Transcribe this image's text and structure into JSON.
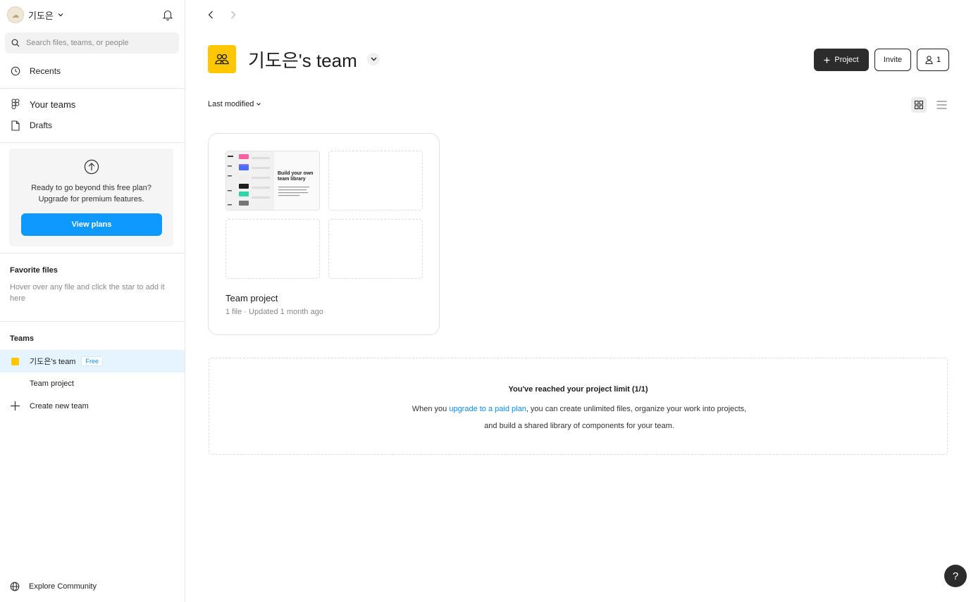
{
  "account": {
    "name": "기도은",
    "avatar_icon": "cloud-avatar-icon"
  },
  "search": {
    "placeholder": "Search files, teams, or people"
  },
  "sidebar": {
    "recents": "Recents",
    "your_teams": "Your teams",
    "drafts": "Drafts",
    "upgrade": {
      "line1": "Ready to go beyond this free plan?",
      "line2": "Upgrade for premium features.",
      "button": "View plans"
    },
    "favorites": {
      "title": "Favorite files",
      "hint": "Hover over any file and click the star to add it here"
    },
    "teams": {
      "title": "Teams",
      "current_team": "기도은's team",
      "badge": "Free",
      "sub_item": "Team project",
      "create": "Create new team"
    },
    "explore": "Explore Community"
  },
  "header": {
    "title": "기도은's team",
    "project_button": "Project",
    "invite_button": "Invite",
    "member_count": "1"
  },
  "toolbar": {
    "sort_label": "Last modified"
  },
  "project_card": {
    "name": "Team project",
    "meta": "1 file · Updated 1 month ago",
    "thumb_heading": "Build your own team library"
  },
  "limit_notice": {
    "title": "You've reached your project limit (1/1)",
    "before_link": "When you ",
    "link": "upgrade to a paid plan",
    "after_link": ", you can create unlimited files, organize your work into projects, and build a shared library of components for your team."
  },
  "help_button": "?",
  "colors": {
    "accent": "#0d99ff",
    "team": "#ffc700",
    "dark_button": "#2c2c2c"
  }
}
